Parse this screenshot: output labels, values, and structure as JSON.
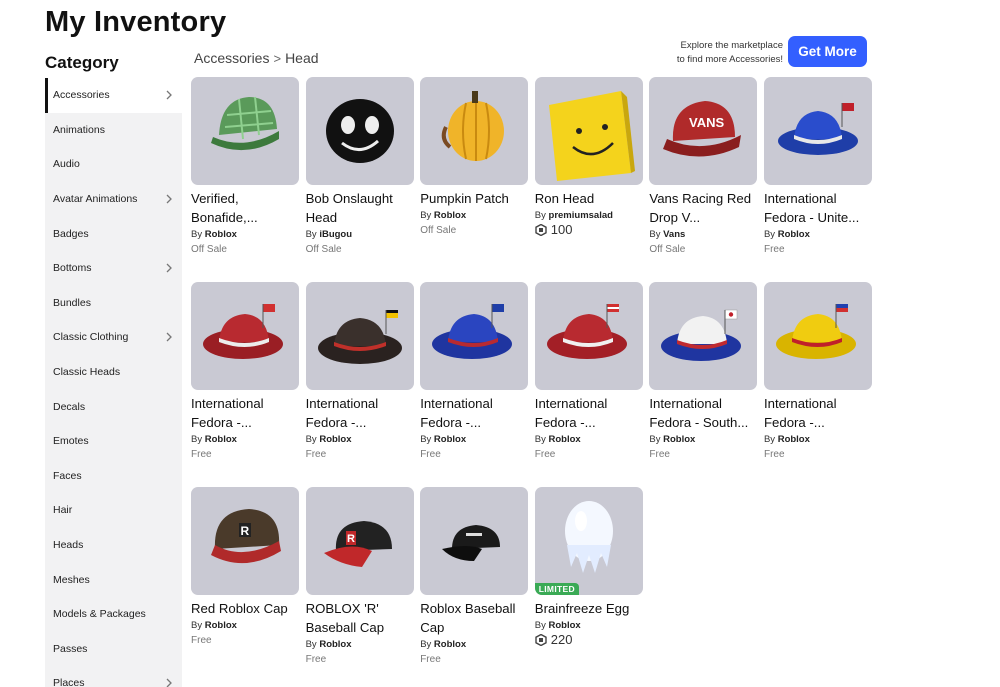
{
  "page": {
    "title": "My Inventory",
    "category_title": "Category"
  },
  "sidebar": {
    "items": [
      {
        "label": "Accessories",
        "chevron": true,
        "active": true
      },
      {
        "label": "Animations",
        "chevron": false
      },
      {
        "label": "Audio",
        "chevron": false
      },
      {
        "label": "Avatar Animations",
        "chevron": true
      },
      {
        "label": "Badges",
        "chevron": false
      },
      {
        "label": "Bottoms",
        "chevron": true
      },
      {
        "label": "Bundles",
        "chevron": false
      },
      {
        "label": "Classic Clothing",
        "chevron": true
      },
      {
        "label": "Classic Heads",
        "chevron": false
      },
      {
        "label": "Decals",
        "chevron": false
      },
      {
        "label": "Emotes",
        "chevron": false
      },
      {
        "label": "Faces",
        "chevron": false
      },
      {
        "label": "Hair",
        "chevron": false
      },
      {
        "label": "Heads",
        "chevron": false
      },
      {
        "label": "Meshes",
        "chevron": false
      },
      {
        "label": "Models & Packages",
        "chevron": false
      },
      {
        "label": "Passes",
        "chevron": false
      },
      {
        "label": "Places",
        "chevron": true
      }
    ]
  },
  "breadcrumb": {
    "parent": "Accessories",
    "separator": ">",
    "current": "Head"
  },
  "promo": {
    "line1": "Explore the marketplace",
    "line2": "to find more Accessories!",
    "button": "Get More"
  },
  "items": [
    {
      "name": "Verified, Bonafide,...",
      "by": "By",
      "creator": "Roblox",
      "price": "Off Sale",
      "icon": "green-plaid-cap-icon"
    },
    {
      "name": "Bob Onslaught Head",
      "by": "By",
      "creator": "iBugou",
      "price": "Off Sale",
      "icon": "black-smiley-head-icon"
    },
    {
      "name": "Pumpkin Patch",
      "by": "By",
      "creator": "Roblox",
      "price": "Off Sale",
      "icon": "pumpkin-icon"
    },
    {
      "name": "Ron Head",
      "by": "By",
      "creator": "premiumsalad",
      "price": "100",
      "robux": true,
      "icon": "yellow-box-head-icon"
    },
    {
      "name": "Vans Racing Red Drop V...",
      "by": "By",
      "creator": "Vans",
      "price": "Off Sale",
      "icon": "red-vans-cap-icon"
    },
    {
      "name": "International Fedora - Unite...",
      "by": "By",
      "creator": "Roblox",
      "price": "Free",
      "icon": "blue-fedora-icon"
    },
    {
      "name": "International Fedora -...",
      "by": "By",
      "creator": "Roblox",
      "price": "Free",
      "icon": "red-fedora-icon"
    },
    {
      "name": "International Fedora -...",
      "by": "By",
      "creator": "Roblox",
      "price": "Free",
      "icon": "black-fedora-icon"
    },
    {
      "name": "International Fedora -...",
      "by": "By",
      "creator": "Roblox",
      "price": "Free",
      "icon": "blue-red-fedora-icon"
    },
    {
      "name": "International Fedora -...",
      "by": "By",
      "creator": "Roblox",
      "price": "Free",
      "icon": "red-white-fedora-icon"
    },
    {
      "name": "International Fedora - South...",
      "by": "By",
      "creator": "Roblox",
      "price": "Free",
      "icon": "white-fedora-icon"
    },
    {
      "name": "International Fedora -...",
      "by": "By",
      "creator": "Roblox",
      "price": "Free",
      "icon": "yellow-fedora-icon"
    },
    {
      "name": "Red Roblox Cap",
      "by": "By",
      "creator": "Roblox",
      "price": "Free",
      "icon": "red-roblox-cap-icon"
    },
    {
      "name": "ROBLOX 'R' Baseball Cap",
      "by": "By",
      "creator": "Roblox",
      "price": "Free",
      "icon": "r-baseball-cap-icon"
    },
    {
      "name": "Roblox Baseball Cap",
      "by": "By",
      "creator": "Roblox",
      "price": "Free",
      "icon": "black-baseball-cap-icon"
    },
    {
      "name": "Brainfreeze Egg",
      "by": "By",
      "creator": "Roblox",
      "price": "220",
      "robux": true,
      "limited": "LIMITED",
      "icon": "ice-egg-icon"
    }
  ],
  "colors": {
    "accent": "#335fff",
    "tile": "#c9c9d3",
    "limited": "#3aaa55",
    "sidebar": "#f2f2f3"
  }
}
